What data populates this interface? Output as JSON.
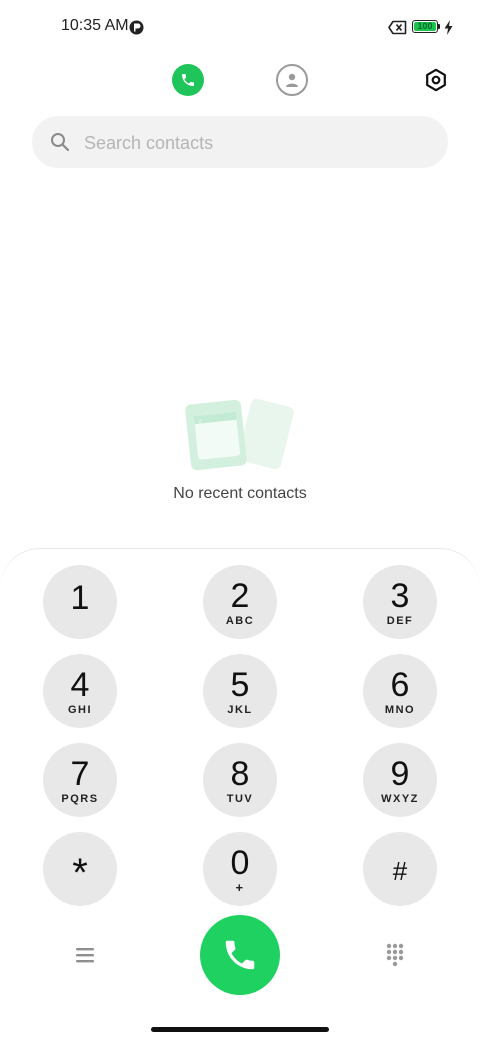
{
  "status_bar": {
    "time": "10:35 AM",
    "battery_level": "100",
    "icons": [
      "notification-icon",
      "sim-blocked-icon",
      "battery-icon",
      "charging-icon"
    ]
  },
  "nav": {
    "tabs": [
      {
        "id": "phone",
        "icon": "phone-icon",
        "active": true
      },
      {
        "id": "contacts",
        "icon": "person-icon",
        "active": false
      }
    ],
    "settings_icon": "settings-icon"
  },
  "search": {
    "placeholder": "Search contacts",
    "value": ""
  },
  "empty_state": {
    "message": "No recent contacts"
  },
  "dialpad": {
    "keys": [
      {
        "digit": "1",
        "letters": ""
      },
      {
        "digit": "2",
        "letters": "ABC"
      },
      {
        "digit": "3",
        "letters": "DEF"
      },
      {
        "digit": "4",
        "letters": "GHI"
      },
      {
        "digit": "5",
        "letters": "JKL"
      },
      {
        "digit": "6",
        "letters": "MNO"
      },
      {
        "digit": "7",
        "letters": "PQRS"
      },
      {
        "digit": "8",
        "letters": "TUV"
      },
      {
        "digit": "9",
        "letters": "WXYZ"
      },
      {
        "digit": "*",
        "letters": ""
      },
      {
        "digit": "0",
        "letters": "+"
      },
      {
        "digit": "#",
        "letters": ""
      }
    ]
  },
  "colors": {
    "accent_green": "#1fd160",
    "key_background": "#e8e8e8",
    "search_background": "#f2f2f2"
  }
}
